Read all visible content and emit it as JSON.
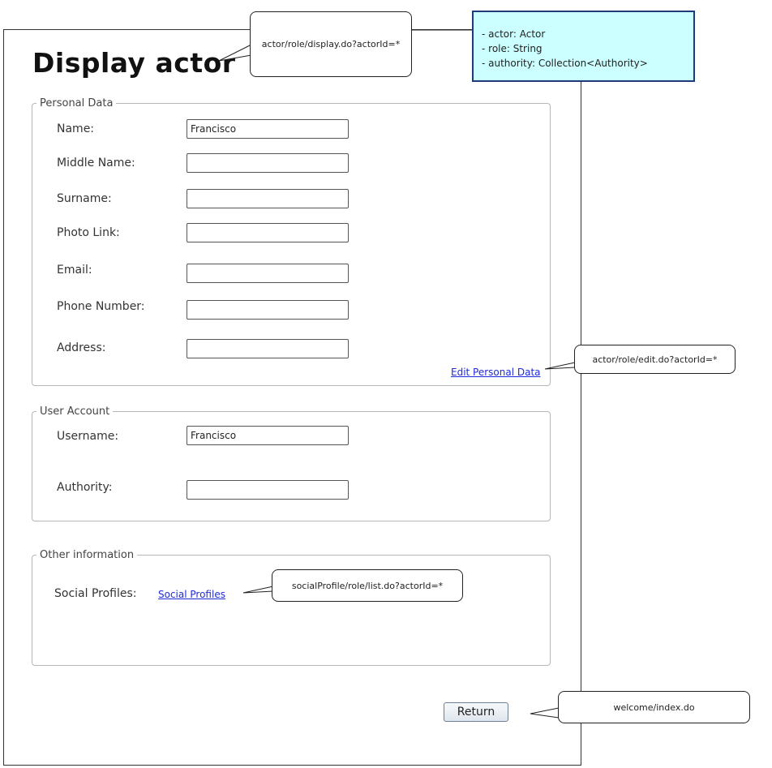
{
  "header": {
    "title": "Display actor"
  },
  "personal_data": {
    "legend": "Personal Data",
    "name_label": "Name:",
    "name_value": "Francisco",
    "middle_name_label": "Middle Name:",
    "middle_name_value": "",
    "surname_label": "Surname:",
    "surname_value": "",
    "photo_link_label": "Photo Link:",
    "photo_link_value": "",
    "email_label": "Email:",
    "email_value": "",
    "phone_label": "Phone Number:",
    "phone_value": "",
    "address_label": "Address:",
    "address_value": "",
    "edit_link": "Edit Personal Data"
  },
  "user_account": {
    "legend": "User Account",
    "username_label": "Username:",
    "username_value": "Francisco",
    "authority_label": "Authority:",
    "authority_value": ""
  },
  "other_information": {
    "legend": "Other information",
    "social_profiles_label": "Social Profiles:",
    "social_profiles_link": "Social Profiles"
  },
  "actions": {
    "return_label": "Return"
  },
  "annotations": {
    "display_url": "actor/role/display.do?actorId=*",
    "edit_url": "actor/role/edit.do?actorId=*",
    "social_url": "socialProfile/role/list.do?actorId=*",
    "return_url": "welcome/index.do",
    "model_lines": [
      "- actor: Actor",
      "- role: String",
      "- authority: Collection<Authority>"
    ]
  },
  "colors": {
    "note_bg": "#ccffff",
    "note_border": "#1f3a7a",
    "link": "#1f2bd6"
  }
}
